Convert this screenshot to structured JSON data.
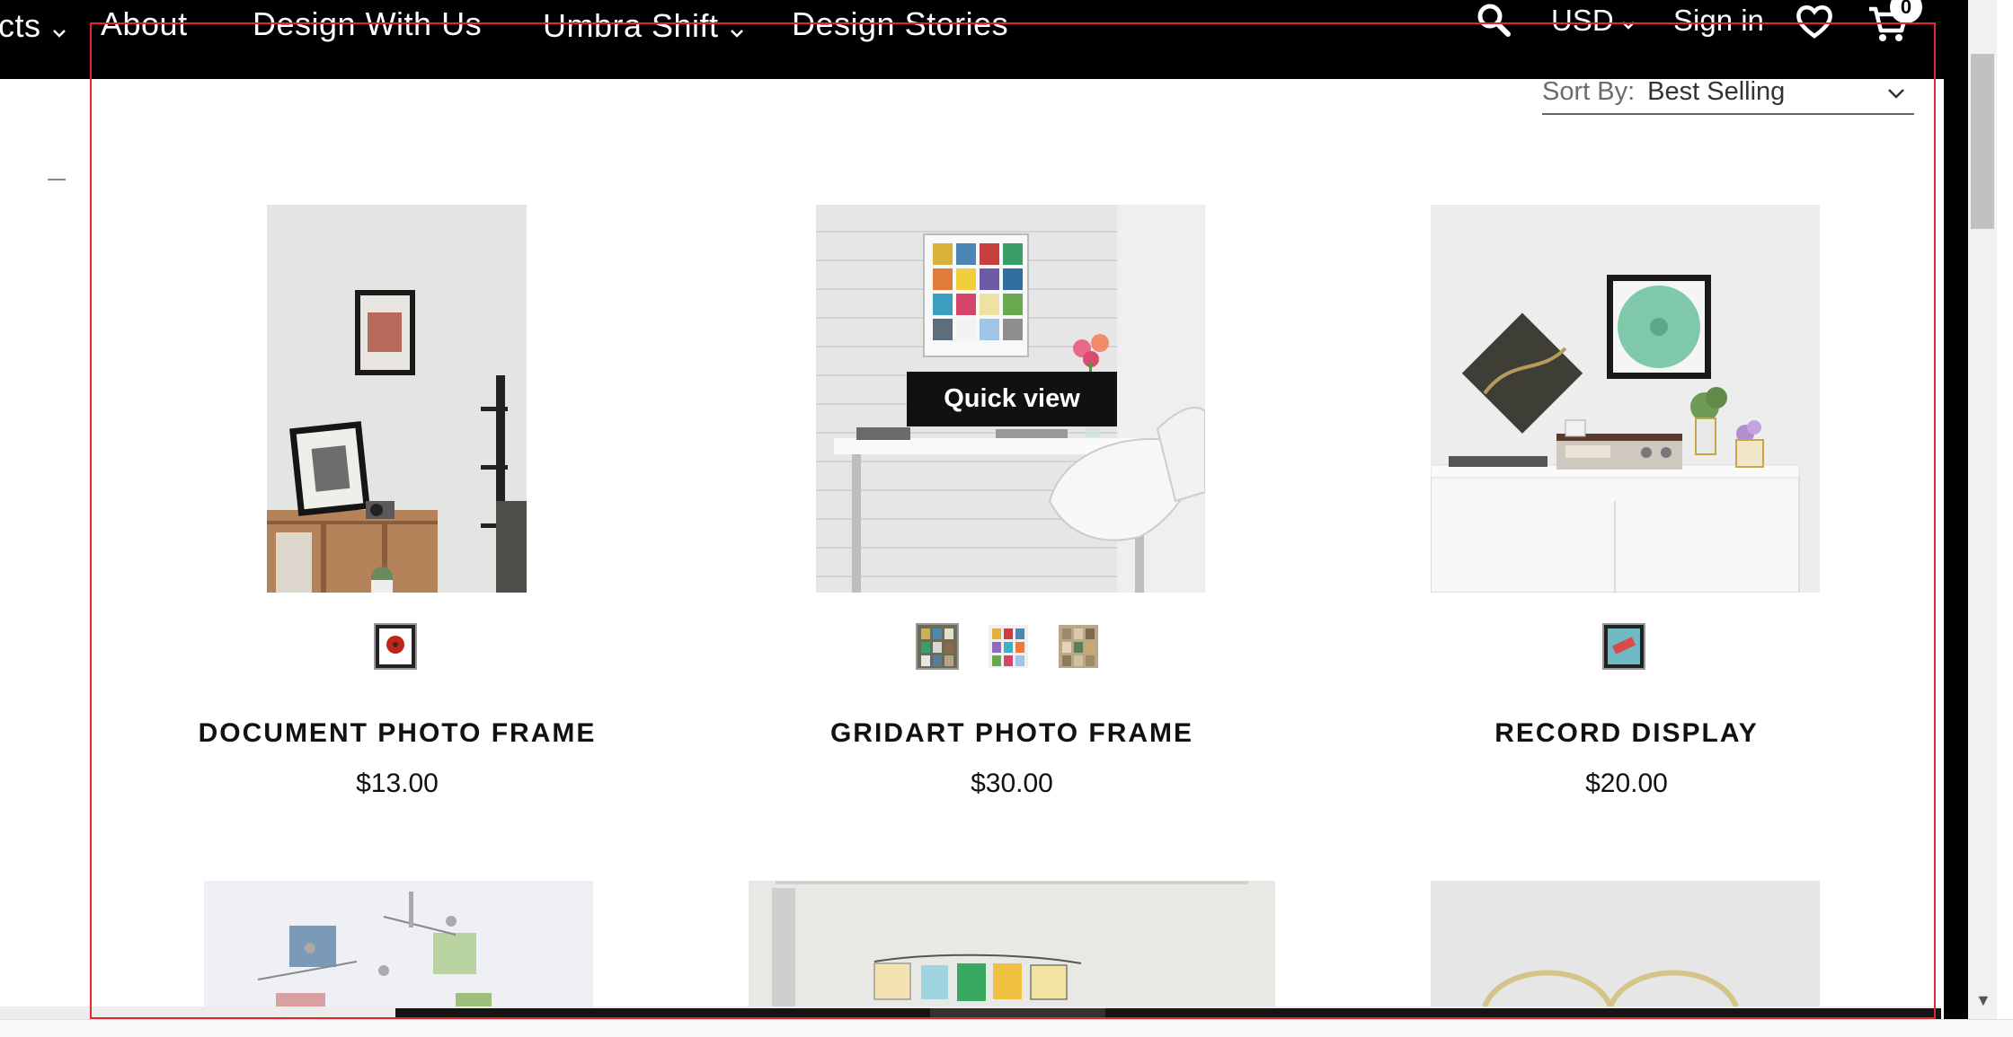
{
  "nav": {
    "items": [
      {
        "label": "cts",
        "dropdown": true
      },
      {
        "label": "About",
        "dropdown": false
      },
      {
        "label": "Design With Us",
        "dropdown": false
      },
      {
        "label": "Umbra Shift",
        "dropdown": true
      },
      {
        "label": "Design Stories",
        "dropdown": false
      }
    ],
    "search_icon": "search-icon",
    "currency": "USD",
    "sign_in": "Sign in",
    "wishlist_icon": "heart-icon",
    "cart_icon": "cart-icon",
    "cart_count": "0"
  },
  "sort": {
    "label": "Sort By:",
    "value": "Best Selling"
  },
  "products": [
    {
      "title": "DOCUMENT PHOTO FRAME",
      "price": "$13.00",
      "swatches": 1
    },
    {
      "title": "GRIDART PHOTO FRAME",
      "price": "$30.00",
      "swatches": 3
    },
    {
      "title": "RECORD DISPLAY",
      "price": "$20.00",
      "swatches": 1
    }
  ],
  "quick_view_label": "Quick view",
  "colors": {
    "nav_background": "#000000",
    "accent_outline": "#e6262e",
    "text": "#111111"
  }
}
